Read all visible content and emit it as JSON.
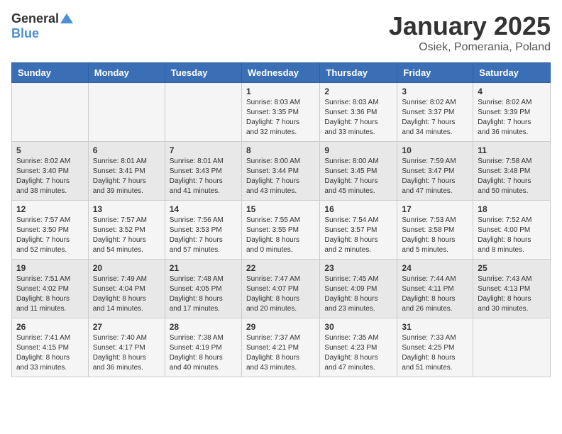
{
  "logo": {
    "line1": "General",
    "line2": "Blue"
  },
  "title": "January 2025",
  "subtitle": "Osiek, Pomerania, Poland",
  "weekdays": [
    "Sunday",
    "Monday",
    "Tuesday",
    "Wednesday",
    "Thursday",
    "Friday",
    "Saturday"
  ],
  "weeks": [
    [
      {
        "day": "",
        "content": ""
      },
      {
        "day": "",
        "content": ""
      },
      {
        "day": "",
        "content": ""
      },
      {
        "day": "1",
        "content": "Sunrise: 8:03 AM\nSunset: 3:35 PM\nDaylight: 7 hours\nand 32 minutes."
      },
      {
        "day": "2",
        "content": "Sunrise: 8:03 AM\nSunset: 3:36 PM\nDaylight: 7 hours\nand 33 minutes."
      },
      {
        "day": "3",
        "content": "Sunrise: 8:02 AM\nSunset: 3:37 PM\nDaylight: 7 hours\nand 34 minutes."
      },
      {
        "day": "4",
        "content": "Sunrise: 8:02 AM\nSunset: 3:39 PM\nDaylight: 7 hours\nand 36 minutes."
      }
    ],
    [
      {
        "day": "5",
        "content": "Sunrise: 8:02 AM\nSunset: 3:40 PM\nDaylight: 7 hours\nand 38 minutes."
      },
      {
        "day": "6",
        "content": "Sunrise: 8:01 AM\nSunset: 3:41 PM\nDaylight: 7 hours\nand 39 minutes."
      },
      {
        "day": "7",
        "content": "Sunrise: 8:01 AM\nSunset: 3:43 PM\nDaylight: 7 hours\nand 41 minutes."
      },
      {
        "day": "8",
        "content": "Sunrise: 8:00 AM\nSunset: 3:44 PM\nDaylight: 7 hours\nand 43 minutes."
      },
      {
        "day": "9",
        "content": "Sunrise: 8:00 AM\nSunset: 3:45 PM\nDaylight: 7 hours\nand 45 minutes."
      },
      {
        "day": "10",
        "content": "Sunrise: 7:59 AM\nSunset: 3:47 PM\nDaylight: 7 hours\nand 47 minutes."
      },
      {
        "day": "11",
        "content": "Sunrise: 7:58 AM\nSunset: 3:48 PM\nDaylight: 7 hours\nand 50 minutes."
      }
    ],
    [
      {
        "day": "12",
        "content": "Sunrise: 7:57 AM\nSunset: 3:50 PM\nDaylight: 7 hours\nand 52 minutes."
      },
      {
        "day": "13",
        "content": "Sunrise: 7:57 AM\nSunset: 3:52 PM\nDaylight: 7 hours\nand 54 minutes."
      },
      {
        "day": "14",
        "content": "Sunrise: 7:56 AM\nSunset: 3:53 PM\nDaylight: 7 hours\nand 57 minutes."
      },
      {
        "day": "15",
        "content": "Sunrise: 7:55 AM\nSunset: 3:55 PM\nDaylight: 8 hours\nand 0 minutes."
      },
      {
        "day": "16",
        "content": "Sunrise: 7:54 AM\nSunset: 3:57 PM\nDaylight: 8 hours\nand 2 minutes."
      },
      {
        "day": "17",
        "content": "Sunrise: 7:53 AM\nSunset: 3:58 PM\nDaylight: 8 hours\nand 5 minutes."
      },
      {
        "day": "18",
        "content": "Sunrise: 7:52 AM\nSunset: 4:00 PM\nDaylight: 8 hours\nand 8 minutes."
      }
    ],
    [
      {
        "day": "19",
        "content": "Sunrise: 7:51 AM\nSunset: 4:02 PM\nDaylight: 8 hours\nand 11 minutes."
      },
      {
        "day": "20",
        "content": "Sunrise: 7:49 AM\nSunset: 4:04 PM\nDaylight: 8 hours\nand 14 minutes."
      },
      {
        "day": "21",
        "content": "Sunrise: 7:48 AM\nSunset: 4:05 PM\nDaylight: 8 hours\nand 17 minutes."
      },
      {
        "day": "22",
        "content": "Sunrise: 7:47 AM\nSunset: 4:07 PM\nDaylight: 8 hours\nand 20 minutes."
      },
      {
        "day": "23",
        "content": "Sunrise: 7:45 AM\nSunset: 4:09 PM\nDaylight: 8 hours\nand 23 minutes."
      },
      {
        "day": "24",
        "content": "Sunrise: 7:44 AM\nSunset: 4:11 PM\nDaylight: 8 hours\nand 26 minutes."
      },
      {
        "day": "25",
        "content": "Sunrise: 7:43 AM\nSunset: 4:13 PM\nDaylight: 8 hours\nand 30 minutes."
      }
    ],
    [
      {
        "day": "26",
        "content": "Sunrise: 7:41 AM\nSunset: 4:15 PM\nDaylight: 8 hours\nand 33 minutes."
      },
      {
        "day": "27",
        "content": "Sunrise: 7:40 AM\nSunset: 4:17 PM\nDaylight: 8 hours\nand 36 minutes."
      },
      {
        "day": "28",
        "content": "Sunrise: 7:38 AM\nSunset: 4:19 PM\nDaylight: 8 hours\nand 40 minutes."
      },
      {
        "day": "29",
        "content": "Sunrise: 7:37 AM\nSunset: 4:21 PM\nDaylight: 8 hours\nand 43 minutes."
      },
      {
        "day": "30",
        "content": "Sunrise: 7:35 AM\nSunset: 4:23 PM\nDaylight: 8 hours\nand 47 minutes."
      },
      {
        "day": "31",
        "content": "Sunrise: 7:33 AM\nSunset: 4:25 PM\nDaylight: 8 hours\nand 51 minutes."
      },
      {
        "day": "",
        "content": ""
      }
    ]
  ]
}
